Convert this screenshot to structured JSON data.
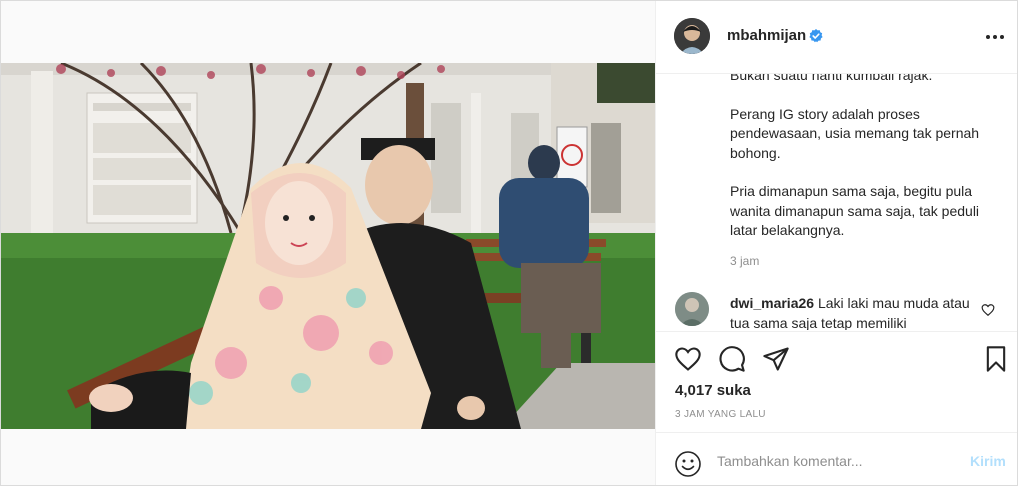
{
  "post": {
    "username": "mbahmijan",
    "verified": true,
    "caption_paragraphs": [
      "Bukan suatu hanti kumbali rajak.",
      "Perang IG story adalah proses pendewasaan, usia memang tak pernah bohong.",
      "Pria dimanapun sama saja, begitu pula wanita dimanapun sama saja, tak peduli latar belakangnya."
    ],
    "caption_time": "3 jam",
    "likes": "4,017 suka",
    "posted_ago": "3 JAM YANG LALU"
  },
  "comment": {
    "username": "dwi_maria26",
    "text": "Laki laki mau muda atau tua sama saja tetap memiliki"
  },
  "add_comment": {
    "placeholder": "Tambahkan komentar...",
    "post_label": "Kirim"
  },
  "colors": {
    "verified": "#3897f0",
    "post_button_disabled": "#b2dffc",
    "secondary_text": "#8e8e8e",
    "border": "#efefef"
  },
  "icons": [
    "verified-badge-icon",
    "more-options-icon",
    "like-icon",
    "comment-icon",
    "share-icon",
    "save-icon",
    "emoji-icon",
    "comment-like-icon"
  ]
}
